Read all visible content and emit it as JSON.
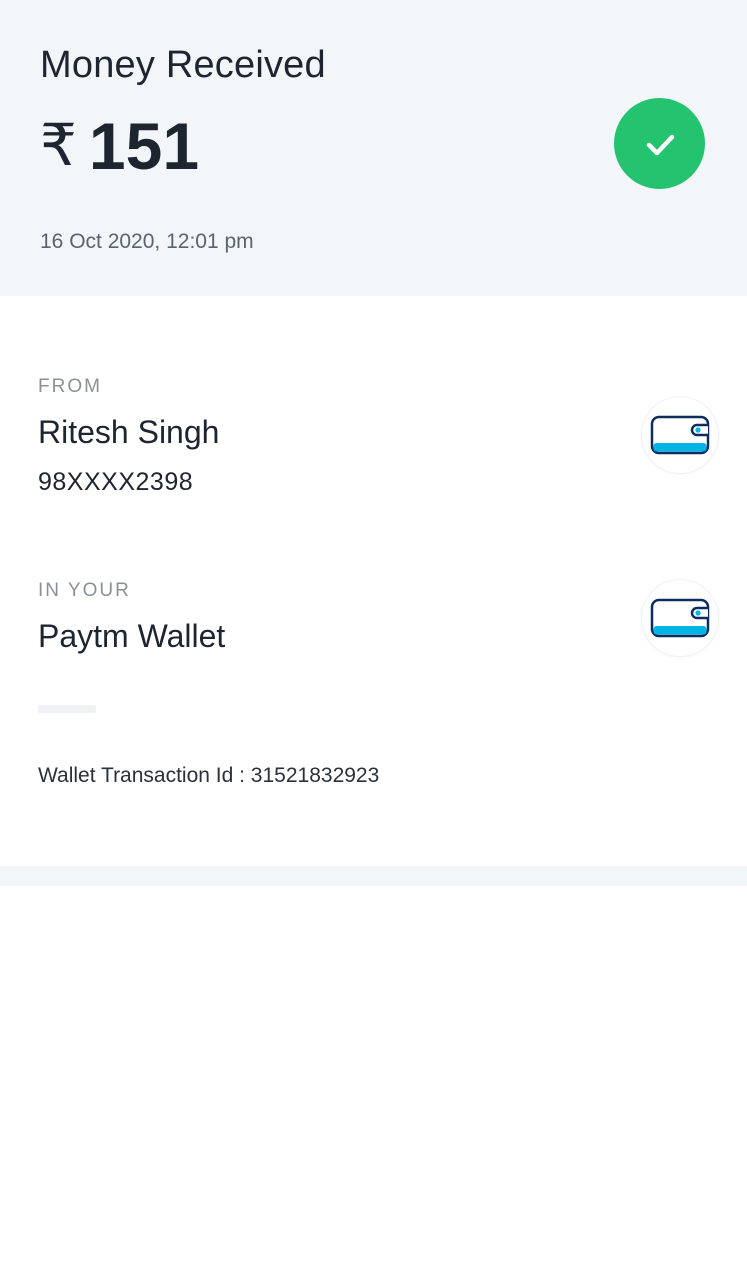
{
  "header": {
    "title": "Money Received",
    "currency_symbol": "₹",
    "amount": "151",
    "datetime": "16 Oct 2020, 12:01 pm",
    "status_icon": "check-icon",
    "status_color": "#23c36f"
  },
  "from": {
    "label": "FROM",
    "name": "Ritesh Singh",
    "phone": "98XXXX2398",
    "icon": "wallet-icon"
  },
  "destination": {
    "label": "IN YOUR",
    "name": "Paytm Wallet",
    "icon": "wallet-icon"
  },
  "transaction": {
    "text": "Wallet Transaction Id : 31521832923"
  },
  "colors": {
    "header_bg": "#f3f6f8",
    "wallet_outline": "#0d2d5c",
    "wallet_accent": "#00b4e6"
  }
}
